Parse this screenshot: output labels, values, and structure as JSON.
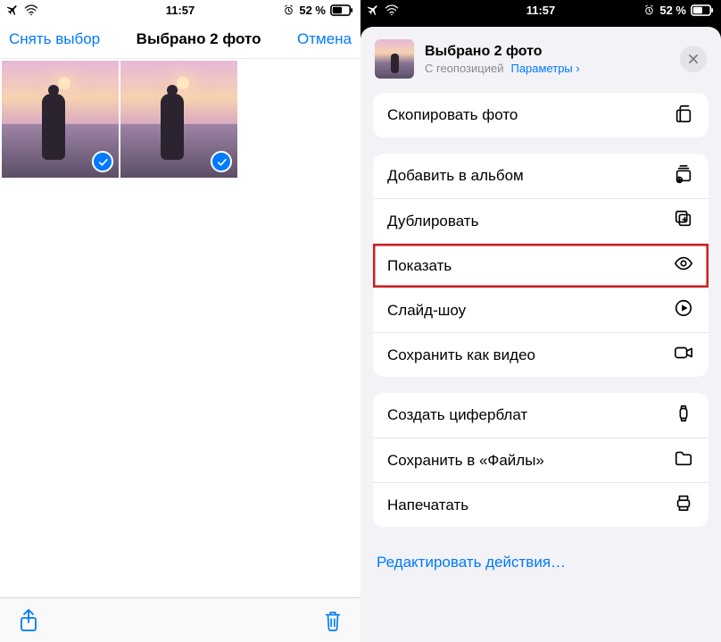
{
  "status": {
    "time": "11:57",
    "battery_text": "52 %"
  },
  "left": {
    "deselect": "Снять выбор",
    "title": "Выбрано 2 фото",
    "cancel": "Отмена"
  },
  "right": {
    "sheet_title": "Выбрано 2 фото",
    "sheet_subtitle": "С геопозицией",
    "sheet_params": "Параметры",
    "edit_actions": "Редактировать действия…",
    "groups": [
      [
        {
          "label": "Скопировать фото",
          "icon": "copy"
        }
      ],
      [
        {
          "label": "Добавить в альбом",
          "icon": "album-add"
        },
        {
          "label": "Дублировать",
          "icon": "duplicate"
        },
        {
          "label": "Показать",
          "icon": "eye",
          "highlight": true
        },
        {
          "label": "Слайд-шоу",
          "icon": "play-circle"
        },
        {
          "label": "Сохранить как видео",
          "icon": "video"
        }
      ],
      [
        {
          "label": "Создать циферблат",
          "icon": "watch"
        },
        {
          "label": "Сохранить в «Файлы»",
          "icon": "folder"
        },
        {
          "label": "Напечатать",
          "icon": "print"
        }
      ]
    ]
  }
}
